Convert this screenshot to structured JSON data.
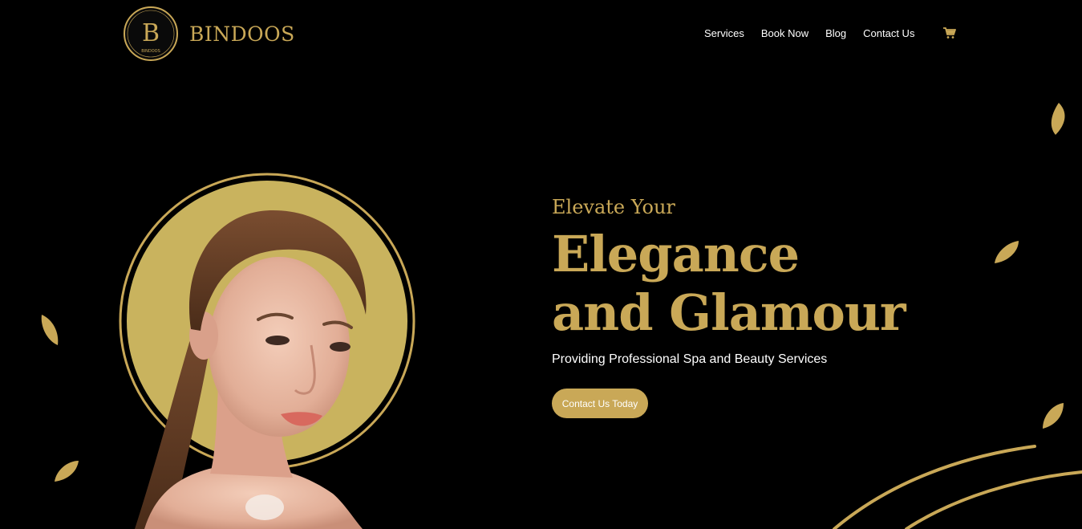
{
  "brand": {
    "name": "BINDOOS",
    "monogram": "B",
    "badge_caption": "BINDOOS",
    "accent_color": "#c9a857"
  },
  "nav": {
    "items": [
      {
        "label": "Services"
      },
      {
        "label": "Book Now"
      },
      {
        "label": "Blog"
      },
      {
        "label": "Contact Us"
      }
    ],
    "cart_icon": "cart-icon"
  },
  "hero": {
    "eyebrow": "Elevate Your",
    "headline_line1": "Elegance",
    "headline_line2": "and Glamour",
    "subhead": "Providing Professional Spa and Beauty Services",
    "cta_label": "Contact Us Today"
  }
}
